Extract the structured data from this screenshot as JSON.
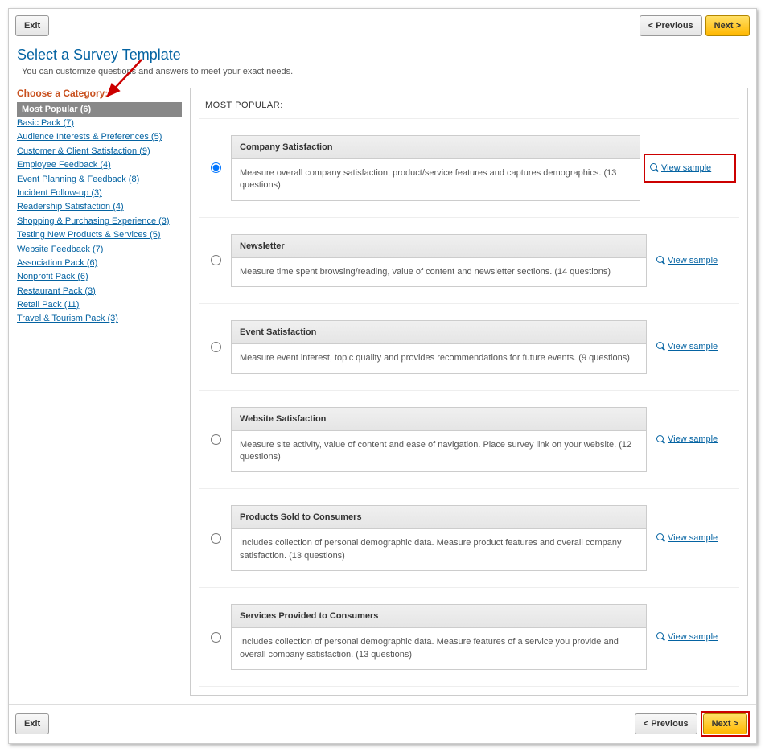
{
  "buttons": {
    "exit": "Exit",
    "previous": "< Previous",
    "next": "Next >"
  },
  "page": {
    "title": "Select a Survey Template",
    "subtitle": "You can customize questions and answers to meet your exact needs.",
    "choose_category": "Choose a Category:"
  },
  "categories": {
    "selected": "Most Popular (6)",
    "items": [
      "Basic Pack (7)",
      "Audience Interests & Preferences (5)",
      "Customer & Client Satisfaction (9)",
      "Employee Feedback (4)",
      "Event Planning & Feedback (8)",
      "Incident Follow-up (3)",
      "Readership Satisfaction (4)",
      "Shopping & Purchasing Experience (3)",
      "Testing New Products & Services (5)",
      "Website Feedback (7)",
      "Association Pack (6)",
      "Nonprofit Pack (6)",
      "Restaurant Pack (3)",
      "Retail Pack (11)",
      "Travel & Tourism Pack (3)"
    ]
  },
  "main": {
    "heading": "MOST POPULAR:",
    "view_sample": "View sample",
    "templates": [
      {
        "title": "Company Satisfaction",
        "desc": "Measure overall company satisfaction, product/service features and captures demographics. (13 questions)",
        "selected": true,
        "highlight": true
      },
      {
        "title": "Newsletter",
        "desc": "Measure time spent browsing/reading, value of content and newsletter sections. (14 questions)",
        "selected": false,
        "highlight": false
      },
      {
        "title": "Event Satisfaction",
        "desc": "Measure event interest, topic quality and provides recommendations for future events. (9 questions)",
        "selected": false,
        "highlight": false
      },
      {
        "title": "Website Satisfaction",
        "desc": "Measure site activity, value of content and ease of navigation. Place survey link on your website. (12 questions)",
        "selected": false,
        "highlight": false
      },
      {
        "title": "Products Sold to Consumers",
        "desc": "Includes collection of personal demographic data. Measure product features and overall company satisfaction. (13 questions)",
        "selected": false,
        "highlight": false
      },
      {
        "title": "Services Provided to Consumers",
        "desc": "Includes collection of personal demographic data. Measure features of a service you provide and overall company satisfaction. (13 questions)",
        "selected": false,
        "highlight": false
      }
    ]
  }
}
